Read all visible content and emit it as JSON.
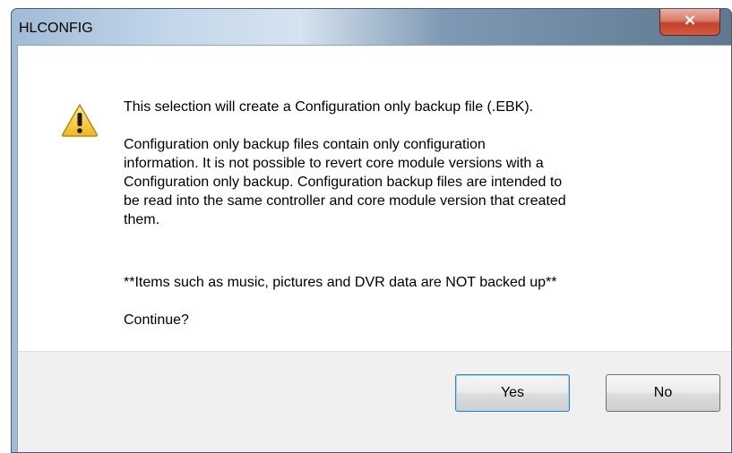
{
  "window": {
    "title": "HLCONFIG",
    "close_icon": "×",
    "close_icon_name": "close-icon"
  },
  "message": {
    "icon": "warning-icon",
    "line1": "This selection will create a Configuration only backup file (.EBK).",
    "paragraph2_lines": [
      "Configuration only backup files contain only configuration",
      "information.  It is not possible to revert core module versions with a",
      "Configuration only backup.  Configuration backup files are intended to",
      "be read into the same controller and core module version that created",
      "them."
    ],
    "line3": "**Items such as music, pictures and DVR data are NOT backed up**",
    "line4": "Continue?"
  },
  "buttons": {
    "yes": "Yes",
    "no": "No"
  },
  "colors": {
    "warning_fill": "#f7d24a",
    "close_red": "#c2412a",
    "footer_bg": "#f0f0f0"
  }
}
